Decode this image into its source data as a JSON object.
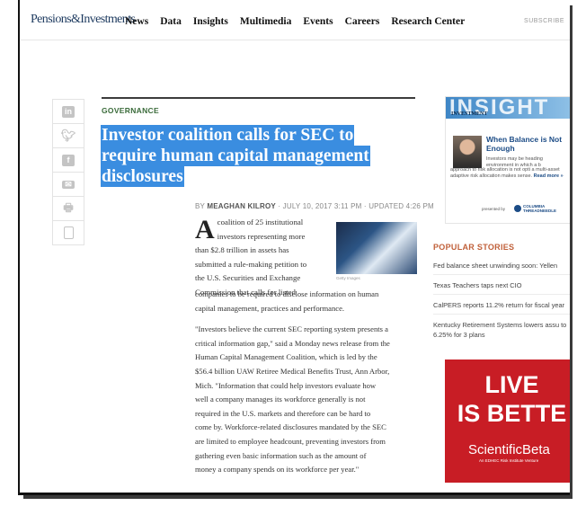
{
  "site": {
    "logo": "Pensions&Investments",
    "nav": [
      "News",
      "Data",
      "Insights",
      "Multimedia",
      "Events",
      "Careers",
      "Research Center"
    ],
    "subscribe": "SUBSCRIBE"
  },
  "share_icons": [
    "linkedin-icon",
    "twitter-icon",
    "facebook-icon",
    "email-icon",
    "print-icon",
    "document-icon"
  ],
  "article": {
    "kicker": "GOVERNANCE",
    "headline_lines": [
      "Investor coalition calls for SEC to",
      "require human capital management",
      "disclosures"
    ],
    "byline_prefix": "BY",
    "author": "MEAGHAN KILROY",
    "date": "JULY 10, 2017 3:11 PM",
    "updated": "UPDATED 4:26 PM",
    "dropcap": "A",
    "para1_lines": [
      "coalition of 25 institutional",
      "investors representing more",
      "than $2.8 trillion in assets has",
      "submitted a rule-making petition to",
      "the U.S. Securities and Exchange",
      "Commission that calls for listed"
    ],
    "para1_tail": [
      "companies to be required to disclose information on human",
      "capital management, practices and performance."
    ],
    "photo_caption": "Getty Images",
    "para2_lines": [
      "\"Investors believe the current SEC reporting system presents a",
      "critical information gap,\" said a Monday news release from the",
      "Human Capital Management Coalition, which is led by the",
      "$56.4 billion UAW Retiree Medical Benefits Trust, Ann Arbor,",
      "Mich. \"Information that could help investors evaluate how",
      "well a company manages its workforce generally is not",
      "required in the U.S. markets and therefore can be hard to",
      "come by. Workforce-related disclosures mandated by the SEC",
      "are limited to employee headcount, preventing investors from",
      "gathering even basic information such as the amount of",
      "money a company spends on its workforce per year.\""
    ]
  },
  "insight": {
    "banner_word": "INSIGHT",
    "banner_tag": "INVESTMENT",
    "title": "When Balance is Not Enough",
    "text_a": "Investors may be heading environment in which a b",
    "text_b": "approach to risk allocation is not opti a multi-asset adaptive risk allocation makes sense.",
    "more": "Read more »",
    "sponsor_label": "presented by",
    "sponsor": "COLUMBIA THREADNEEDLE"
  },
  "popular": {
    "heading": "POPULAR STORIES",
    "items": [
      "Fed balance sheet unwinding soon: Yellen",
      "Texas Teachers taps next CIO",
      "CalPERS reports 11.2% return for fiscal year",
      "Kentucky Retirement Systems lowers assu to 6.25% for 3 plans"
    ]
  },
  "ad": {
    "line1": "LIVE",
    "line2": "IS BETTE",
    "brand": "ScientificBeta",
    "sub": "An EDHEC Risk Institute Venture"
  },
  "colors": {
    "headline_highlight": "#3a8de0",
    "ad_red": "#c81d25",
    "kicker_green": "#3a6b3a",
    "popular_heading": "#c0603a"
  }
}
